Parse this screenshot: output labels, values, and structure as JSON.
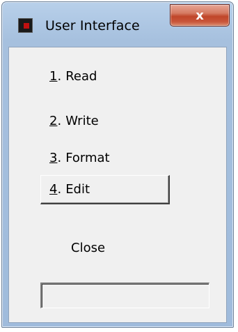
{
  "window": {
    "title": "User Interface",
    "close_glyph": "x"
  },
  "menu": {
    "items": [
      {
        "number": "1",
        "label": "Read"
      },
      {
        "number": "2",
        "label": "Write"
      },
      {
        "number": "3",
        "label": "Format"
      },
      {
        "number": "4",
        "label": "Edit",
        "selected": true
      }
    ]
  },
  "footer": {
    "close_label": "Close",
    "status_value": ""
  },
  "icons": {
    "app": "app-icon",
    "close": "close-icon"
  },
  "colors": {
    "titlebar": "#a6c0de",
    "close_button": "#c9553a",
    "client_background": "#f0f0f0"
  }
}
